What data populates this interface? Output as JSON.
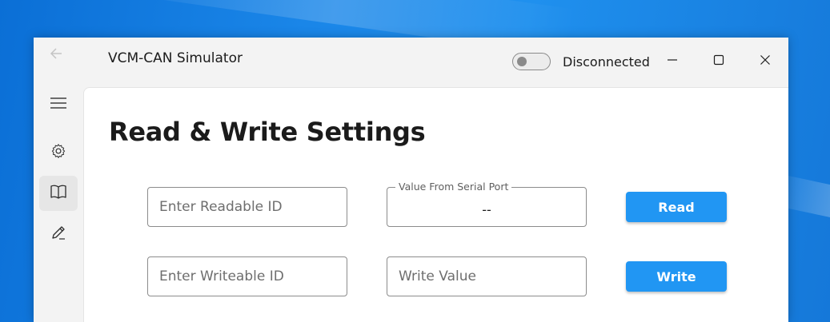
{
  "window": {
    "title": "VCM-CAN Simulator",
    "back_icon": "back-arrow-icon",
    "connection": {
      "status_label": "Disconnected",
      "toggle_on": false
    },
    "caption": {
      "minimize": "minimize-icon",
      "maximize": "maximize-icon",
      "close": "close-icon"
    }
  },
  "nav": {
    "items": [
      {
        "icon": "hamburger-menu-icon",
        "selected": false
      },
      {
        "icon": "gear-icon",
        "selected": false
      },
      {
        "icon": "book-icon",
        "selected": true
      },
      {
        "icon": "pencil-icon",
        "selected": false
      }
    ]
  },
  "page": {
    "title": "Read & Write Settings",
    "read_row": {
      "id_placeholder": "Enter Readable ID",
      "value_label": "Value From Serial Port",
      "value": "--",
      "button_label": "Read"
    },
    "write_row": {
      "id_placeholder": "Enter Writeable ID",
      "value_placeholder": "Write Value",
      "button_label": "Write"
    }
  },
  "colors": {
    "accent": "#2196F3",
    "window_bg": "#F3F3F3",
    "content_bg": "#FFFFFF",
    "desktop": "#1A86E8"
  }
}
